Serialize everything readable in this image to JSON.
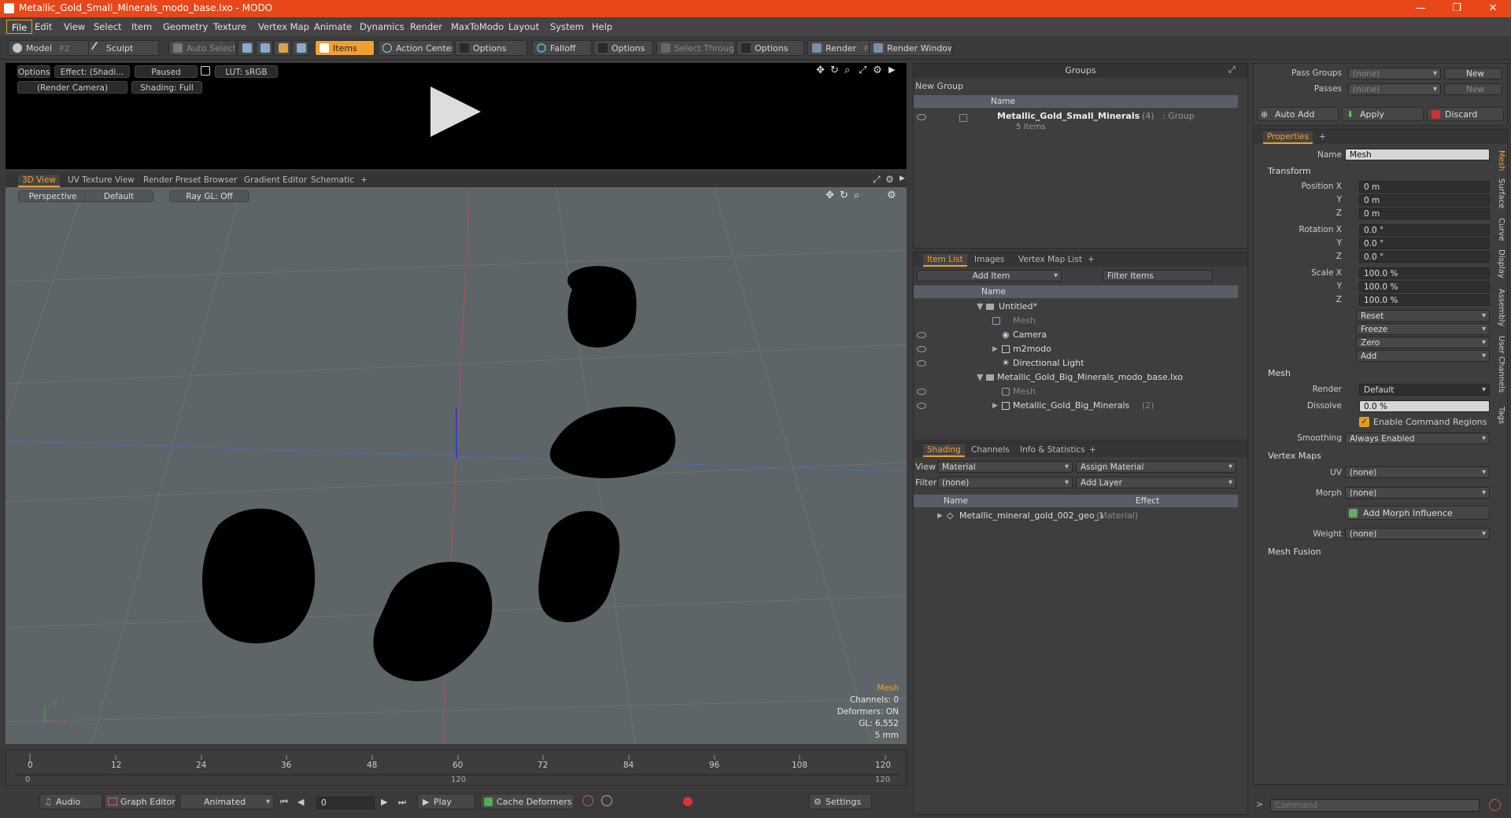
{
  "window": {
    "title": "Metallic_Gold_Small_Minerals_modo_base.lxo - MODO",
    "controls": [
      "—",
      "❐",
      "✕"
    ]
  },
  "menu": [
    "File",
    "Edit",
    "View",
    "Select",
    "Item",
    "Geometry",
    "Texture",
    "Vertex Map",
    "Animate",
    "Dynamics",
    "Render",
    "MaxToModo",
    "Layout",
    "System",
    "Help"
  ],
  "toolbar": {
    "model": "Model",
    "model_key": "F2",
    "sculpt": "Sculpt",
    "auto_select": "Auto Select",
    "items": "Items",
    "action_center": "Action Center",
    "options1": "Options",
    "falloff": "Falloff",
    "options2": "Options",
    "select_through": "Select Through",
    "options3": "Options",
    "render": "Render",
    "render_key": "F9",
    "render_window": "Render Window"
  },
  "preview": {
    "options": "Options",
    "effect": "Effect: (Shadi...",
    "paused": "Paused",
    "lut": "LUT: sRGB",
    "camera": "(Render Camera)",
    "shading": "Shading: Full"
  },
  "viewport_tabs": [
    "3D View",
    "UV Texture View",
    "Render Preset Browser",
    "Gradient Editor",
    "Schematic",
    "+"
  ],
  "viewport": {
    "perspective": "Perspective",
    "default": "Default",
    "raygl": "Ray GL: Off",
    "hud": {
      "type": "Mesh",
      "channels": "Channels: 0",
      "deformers": "Deformers: ON",
      "gl": "GL: 6,552",
      "scale": "5 mm"
    },
    "axis": {
      "y": "Y",
      "x": "X"
    }
  },
  "timeline": {
    "ticks": [
      "0",
      "12",
      "24",
      "36",
      "48",
      "60",
      "72",
      "84",
      "96",
      "108",
      "120"
    ],
    "start": "0",
    "end": "120",
    "mid": "120"
  },
  "bottombar": {
    "audio": "Audio",
    "graph_editor": "Graph Editor",
    "animated": "Animated",
    "frame": "0",
    "play": "Play",
    "cache": "Cache Deformers",
    "settings": "Settings"
  },
  "groups": {
    "header": "Groups",
    "new_group": "New Group",
    "col_name": "Name",
    "group_name": "Metallic_Gold_Small_Minerals",
    "group_count": "(4)",
    "group_type": ": Group",
    "group_items": "5 Items"
  },
  "itemlist": {
    "tabs": [
      "Item List",
      "Images",
      "Vertex Map List",
      "+"
    ],
    "add_item": "Add Item",
    "filter": "Filter Items",
    "col_name": "Name",
    "rows": [
      {
        "label": "Untitled*",
        "dim": false
      },
      {
        "label": "Mesh",
        "dim": true
      },
      {
        "label": "Camera",
        "dim": false
      },
      {
        "label": "m2modo",
        "dim": false
      },
      {
        "label": "Directional Light",
        "dim": false
      },
      {
        "label": "Metallic_Gold_Big_Minerals_modo_base.lxo",
        "dim": false
      },
      {
        "label": "Mesh",
        "dim": true
      },
      {
        "label": "Metallic_Gold_Big_Minerals",
        "dim": false
      }
    ],
    "big_count": "(2)"
  },
  "shading": {
    "tabs": [
      "Shading",
      "Channels",
      "Info & Statistics",
      "+"
    ],
    "view_label": "View",
    "view_value": "Material",
    "assign": "Assign Material",
    "filter_label": "Filter",
    "filter_value": "(none)",
    "add_layer": "Add Layer",
    "col_name": "Name",
    "col_effect": "Effect",
    "material": "Metallic_mineral_gold_002_geo_1",
    "material_type": "(Material)"
  },
  "passes": {
    "pass_groups": "Pass Groups",
    "pass_groups_val": "(none)",
    "new": "New",
    "passes": "Passes",
    "passes_val": "(none)",
    "new2": "New",
    "auto_add": "Auto Add",
    "apply": "Apply",
    "discard": "Discard"
  },
  "properties": {
    "tab": "Properties",
    "plus": "+",
    "name_label": "Name",
    "name_value": "Mesh",
    "transform": "Transform",
    "rows": [
      {
        "label": "Position X",
        "value": "0 m"
      },
      {
        "label": "Y",
        "value": "0 m"
      },
      {
        "label": "Z",
        "value": "0 m"
      },
      {
        "label": "Rotation X",
        "value": "0.0 °"
      },
      {
        "label": "Y",
        "value": "0.0 °"
      },
      {
        "label": "Z",
        "value": "0.0 °"
      },
      {
        "label": "Scale X",
        "value": "100.0 %"
      },
      {
        "label": "Y",
        "value": "100.0 %"
      },
      {
        "label": "Z",
        "value": "100.0 %"
      }
    ],
    "reset": "Reset",
    "freeze": "Freeze",
    "zero": "Zero",
    "add": "Add",
    "mesh_section": "Mesh",
    "render_label": "Render",
    "render_value": "Default",
    "dissolve_label": "Dissolve",
    "dissolve_value": "0.0 %",
    "command_regions": "Enable Command Regions",
    "smoothing_label": "Smoothing",
    "smoothing_value": "Always Enabled",
    "vertex_maps": "Vertex Maps",
    "uv_label": "UV",
    "uv_value": "(none)",
    "morph_label": "Morph",
    "morph_value": "(none)",
    "add_morph": "Add Morph Influence",
    "weight_label": "Weight",
    "weight_value": "(none)",
    "mesh_fusion": "Mesh Fusion",
    "side_tabs": [
      "Mesh",
      "Surface",
      "Curve",
      "Display",
      "Assembly",
      "User Channels",
      "Tags"
    ]
  },
  "command": {
    "placeholder": "Command"
  },
  "colors": {
    "accent": "#f0a030",
    "titlebar": "#e8471a",
    "viewport": "#5e6569"
  }
}
